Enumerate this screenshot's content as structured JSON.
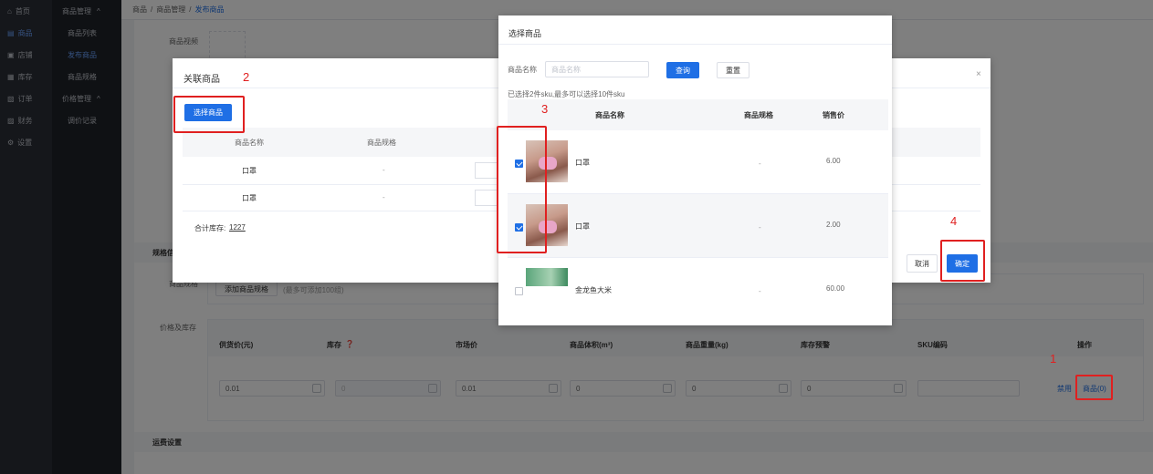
{
  "sidebar": {
    "items": [
      {
        "label": "首页",
        "icon": "home-icon"
      },
      {
        "label": "商品",
        "icon": "goods-icon",
        "active": true
      },
      {
        "label": "店铺",
        "icon": "shop-icon"
      },
      {
        "label": "库存",
        "icon": "stock-icon"
      },
      {
        "label": "订单",
        "icon": "order-icon"
      },
      {
        "label": "财务",
        "icon": "finance-icon"
      },
      {
        "label": "设置",
        "icon": "settings-icon"
      }
    ]
  },
  "subnav": {
    "group1": "商品管理",
    "items1": [
      "商品列表",
      "发布商品",
      "商品规格"
    ],
    "group2": "价格管理",
    "items2": [
      "调价记录"
    ]
  },
  "breadcrumb": {
    "a": "商品",
    "b": "商品管理",
    "c": "发布商品",
    "sep": "/"
  },
  "form": {
    "video_label": "商品视频",
    "spec_section_title": "规格信息",
    "spec_label": "商品规格",
    "add_spec_btn": "添加商品规格",
    "add_spec_hint": "(最多可添加100组)",
    "price_label": "价格及库存",
    "columns": [
      "供货价(元)",
      "库存",
      "市场价",
      "商品体积(m³)",
      "商品重量(kg)",
      "库存预警",
      "SKU编码",
      "操作"
    ],
    "row": {
      "supply_price": "0.01",
      "stock": "0",
      "market_price": "0.01",
      "volume": "0",
      "weight": "0",
      "warn": "0",
      "sku": ""
    },
    "disable_link": "禁用",
    "goods_link": "商品(0)",
    "shipping_title": "运费设置"
  },
  "link_modal": {
    "title": "关联商品",
    "select_btn": "选择商品",
    "col_name": "商品名称",
    "col_spec": "商品规格",
    "rows": [
      {
        "name": "口罩",
        "spec": "-"
      },
      {
        "name": "口罩",
        "spec": "-"
      }
    ],
    "total_label": "合计库存:",
    "total_value": "1227",
    "cancel": "取消",
    "confirm": "确定",
    "close": "×"
  },
  "select_modal": {
    "title": "选择商品",
    "search_label": "商品名称",
    "search_placeholder": "商品名称",
    "query_btn": "查询",
    "reset_btn": "重置",
    "selected_hint": "已选择2件sku,最多可以选择10件sku",
    "col_name": "商品名称",
    "col_spec": "商品规格",
    "col_price": "销售价",
    "rows": [
      {
        "name": "口罩",
        "spec": "-",
        "price": "6.00",
        "checked": true
      },
      {
        "name": "口罩",
        "spec": "-",
        "price": "2.00",
        "checked": true
      },
      {
        "name": "金龙鱼大米",
        "spec": "-",
        "price": "60.00",
        "checked": false
      }
    ]
  },
  "annotations": {
    "s1": "1",
    "s2": "2",
    "s3": "3",
    "s4": "4"
  },
  "colors": {
    "accent": "#1f6fe5",
    "annotation": "#e02020",
    "sidebar": "#2b2f36"
  }
}
